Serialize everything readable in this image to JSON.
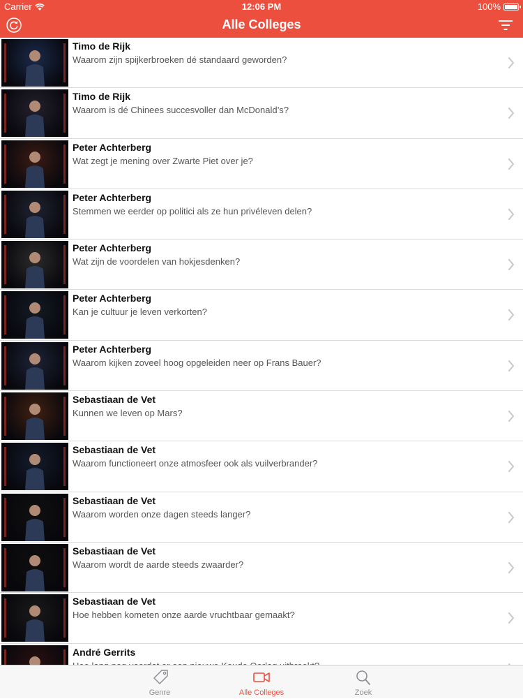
{
  "status_bar": {
    "carrier": "Carrier",
    "time": "12:06 PM",
    "battery": "100%"
  },
  "nav": {
    "title": "Alle Colleges",
    "refresh_icon": "refresh-icon",
    "filter_icon": "filter-icon"
  },
  "colors": {
    "accent": "#ec4f3e",
    "tab_inactive": "#8e8e93"
  },
  "colleges": [
    {
      "speaker": "Timo de Rijk",
      "title": "Waarom zijn spijkerbroeken dé standaard geworden?"
    },
    {
      "speaker": "Timo de Rijk",
      "title": "Waarom is dé Chinees succesvoller dan McDonald’s?"
    },
    {
      "speaker": "Peter Achterberg",
      "title": "Wat zegt je mening over Zwarte Piet over je?"
    },
    {
      "speaker": "Peter Achterberg",
      "title": "Stemmen we eerder op politici als ze hun privéleven delen?"
    },
    {
      "speaker": "Peter Achterberg",
      "title": "Wat zijn de voordelen van hokjesdenken?"
    },
    {
      "speaker": "Peter Achterberg",
      "title": "Kan je cultuur je leven verkorten?"
    },
    {
      "speaker": "Peter Achterberg",
      "title": "Waarom kijken zoveel hoog opgeleiden neer op Frans Bauer?"
    },
    {
      "speaker": "Sebastiaan de Vet",
      "title": "Kunnen we leven op Mars?"
    },
    {
      "speaker": "Sebastiaan de Vet",
      "title": "Waarom functioneert onze atmosfeer ook als vuilverbrander?"
    },
    {
      "speaker": "Sebastiaan de Vet",
      "title": "Waarom worden onze dagen steeds langer?"
    },
    {
      "speaker": "Sebastiaan de Vet",
      "title": "Waarom wordt de aarde steeds zwaarder?"
    },
    {
      "speaker": "Sebastiaan de Vet",
      "title": "Hoe hebben kometen onze aarde vruchtbaar gemaakt?"
    },
    {
      "speaker": "André Gerrits",
      "title": "Hoe lang nog voordat er een nieuwe Koude Oorlog uitbreekt?"
    }
  ],
  "tabs": [
    {
      "label": "Genre",
      "icon": "tag-icon",
      "active": false
    },
    {
      "label": "Alle Colleges",
      "icon": "video-camera-icon",
      "active": true
    },
    {
      "label": "Zoek",
      "icon": "search-icon",
      "active": false
    }
  ]
}
